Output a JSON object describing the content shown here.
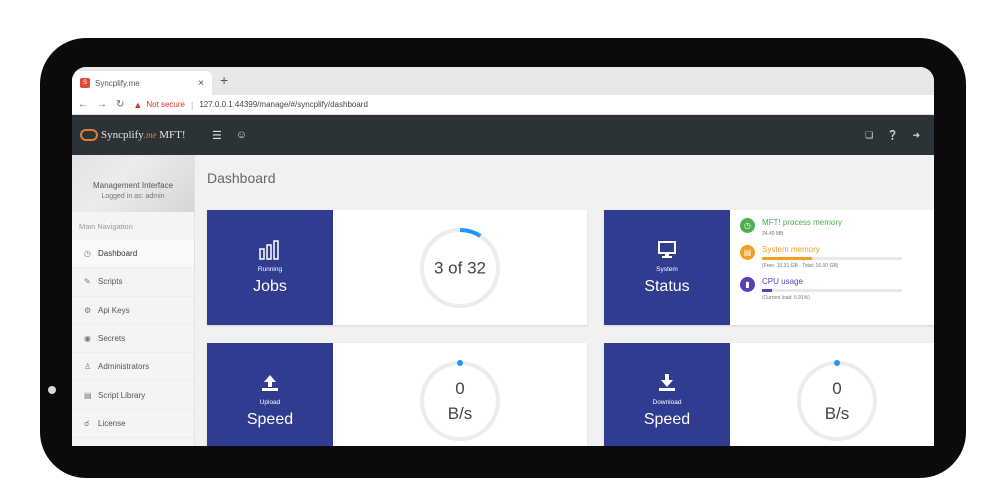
{
  "browser": {
    "tab_title": "Syncplify.me",
    "tab_close": "×",
    "new_tab": "+",
    "security_label": "Not secure",
    "url": "127.0.0.1:44399/manage/#/syncplify/dashboard",
    "favicon_text": "S"
  },
  "header": {
    "logo_name": "Syncplify",
    "logo_suffix": ".me",
    "logo_product": " MFT!"
  },
  "sidebar": {
    "panel_title": "Management Interface",
    "panel_subtitle": "Logged in as: admin",
    "nav_header": "Main Navigation",
    "items": [
      {
        "label": "Dashboard",
        "icon": "dashboard-icon"
      },
      {
        "label": "Scripts",
        "icon": "pencil-icon"
      },
      {
        "label": "Api Keys",
        "icon": "key-icon"
      },
      {
        "label": "Secrets",
        "icon": "eye-icon"
      },
      {
        "label": "Administrators",
        "icon": "admin-icon"
      },
      {
        "label": "Script Library",
        "icon": "library-icon"
      },
      {
        "label": "License",
        "icon": "license-icon"
      }
    ]
  },
  "page": {
    "title": "Dashboard"
  },
  "cards": {
    "jobs": {
      "small": "Running",
      "big": "Jobs",
      "value": "3 of 32",
      "progress": 0.09
    },
    "status": {
      "small": "System",
      "big": "Status",
      "items": [
        {
          "title": "MFT! process memory",
          "sub": "24.40 MB",
          "color": "#4caf50",
          "fill": 0
        },
        {
          "title": "System memory",
          "sub": "(Free: 10.31 GB - Total: 16.00 GB)",
          "color": "#f0a020",
          "fill": 0.36
        },
        {
          "title": "CPU usage",
          "sub": "(Current load: 6.91%)",
          "color": "#5b3fb5",
          "fill": 0.07
        }
      ]
    },
    "upload": {
      "small": "Upload",
      "big": "Speed",
      "value": "0",
      "unit": "B/s"
    },
    "download": {
      "small": "Download",
      "big": "Speed",
      "value": "0",
      "unit": "B/s"
    }
  },
  "colors": {
    "card_accent": "#2f3c8f",
    "ring_progress": "#2196f3",
    "header_bg": "#2b3336"
  }
}
